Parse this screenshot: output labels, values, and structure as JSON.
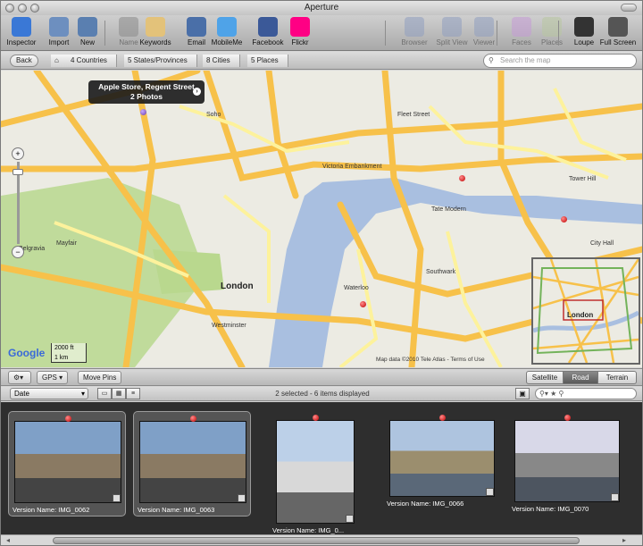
{
  "window": {
    "title": "Aperture"
  },
  "toolbar": {
    "items": [
      {
        "label": "Inspector",
        "icon": "info-icon",
        "color": "#3a78d6"
      },
      {
        "label": "Import",
        "icon": "import-arrow-icon",
        "color": "#6d8fbf"
      },
      {
        "label": "New",
        "icon": "new-project-icon",
        "color": "#5a7fb0"
      },
      {
        "label": "Name",
        "icon": "name-person-icon",
        "color": "#8a8a8a"
      },
      {
        "label": "Keywords",
        "icon": "keywords-tag-icon",
        "color": "#e3c27a"
      },
      {
        "label": "Email",
        "icon": "email-icon",
        "color": "#4a6fa8"
      },
      {
        "label": "MobileMe",
        "icon": "mobileme-cloud-icon",
        "color": "#4fa3e8"
      },
      {
        "label": "Facebook",
        "icon": "facebook-icon",
        "color": "#3b5998"
      },
      {
        "label": "Flickr",
        "icon": "flickr-icon",
        "color": "#ff0084"
      },
      {
        "label": "Browser",
        "icon": "browser-grid-icon",
        "color": "#8f9fbf"
      },
      {
        "label": "Split View",
        "icon": "split-view-icon",
        "color": "#8f9fbf"
      },
      {
        "label": "Viewer",
        "icon": "viewer-icon",
        "color": "#8f9fbf"
      },
      {
        "label": "Faces",
        "icon": "faces-icon",
        "color": "#c59ad6"
      },
      {
        "label": "Places",
        "icon": "places-icon",
        "color": "#b8c6a0"
      },
      {
        "label": "Loupe",
        "icon": "loupe-icon",
        "color": "#333333"
      },
      {
        "label": "Full Screen",
        "icon": "full-screen-icon",
        "color": "#555555"
      }
    ]
  },
  "nav": {
    "back": "Back",
    "home_icon": "home-icon",
    "crumbs": [
      "4 Countries",
      "5 States/Provinces",
      "8 Cities",
      "5 Places"
    ],
    "search_placeholder": "Search the map"
  },
  "map": {
    "callout_title": "Apple Store, Regent Street",
    "callout_sub": "2 Photos",
    "city_label": "London",
    "scale": [
      "2000 ft",
      "1 km"
    ],
    "google": "Google",
    "copyright": "Map data ©2010 Tele Atlas - Terms of Use",
    "overview_label": "London",
    "place_labels": [
      "Soho",
      "Waterloo",
      "Southwark",
      "City Hall",
      "Tate Modern",
      "Belgravia",
      "Mayfair",
      "Westminster",
      "Fleet Street",
      "Tower Hill",
      "Victoria Embankment"
    ],
    "road_colors": {
      "major": "#f7c14a",
      "minor": "#fdf29c",
      "park": "#b9d88e",
      "water": "#a9bfe0",
      "base": "#ecebe3"
    }
  },
  "mapbar": {
    "gps_label": "GPS",
    "move_pins": "Move Pins",
    "modes": [
      "Satellite",
      "Road",
      "Terrain"
    ],
    "active_mode": "Road"
  },
  "browse": {
    "sort": "Date",
    "status": "2 selected - 6 items displayed"
  },
  "filmstrip": {
    "thumbs": [
      {
        "caption": "Version Name: IMG_0062",
        "selected": true,
        "colors": [
          "#7fa0c7",
          "#8a7a63",
          "#444444"
        ]
      },
      {
        "caption": "Version Name: IMG_0063",
        "selected": true,
        "colors": [
          "#7fa0c7",
          "#8a7a63",
          "#444444"
        ]
      },
      {
        "caption": "Version Name: IMG_0...",
        "selected": false,
        "colors": [
          "#bcd0e8",
          "#d8d8d8",
          "#666666"
        ]
      },
      {
        "caption": "Version Name: IMG_0066",
        "selected": false,
        "colors": [
          "#aec4df",
          "#9b8e6e",
          "#5a6878"
        ]
      },
      {
        "caption": "Version Name: IMG_0070",
        "selected": false,
        "colors": [
          "#d8d8e8",
          "#888888",
          "#4d5560"
        ]
      }
    ]
  }
}
